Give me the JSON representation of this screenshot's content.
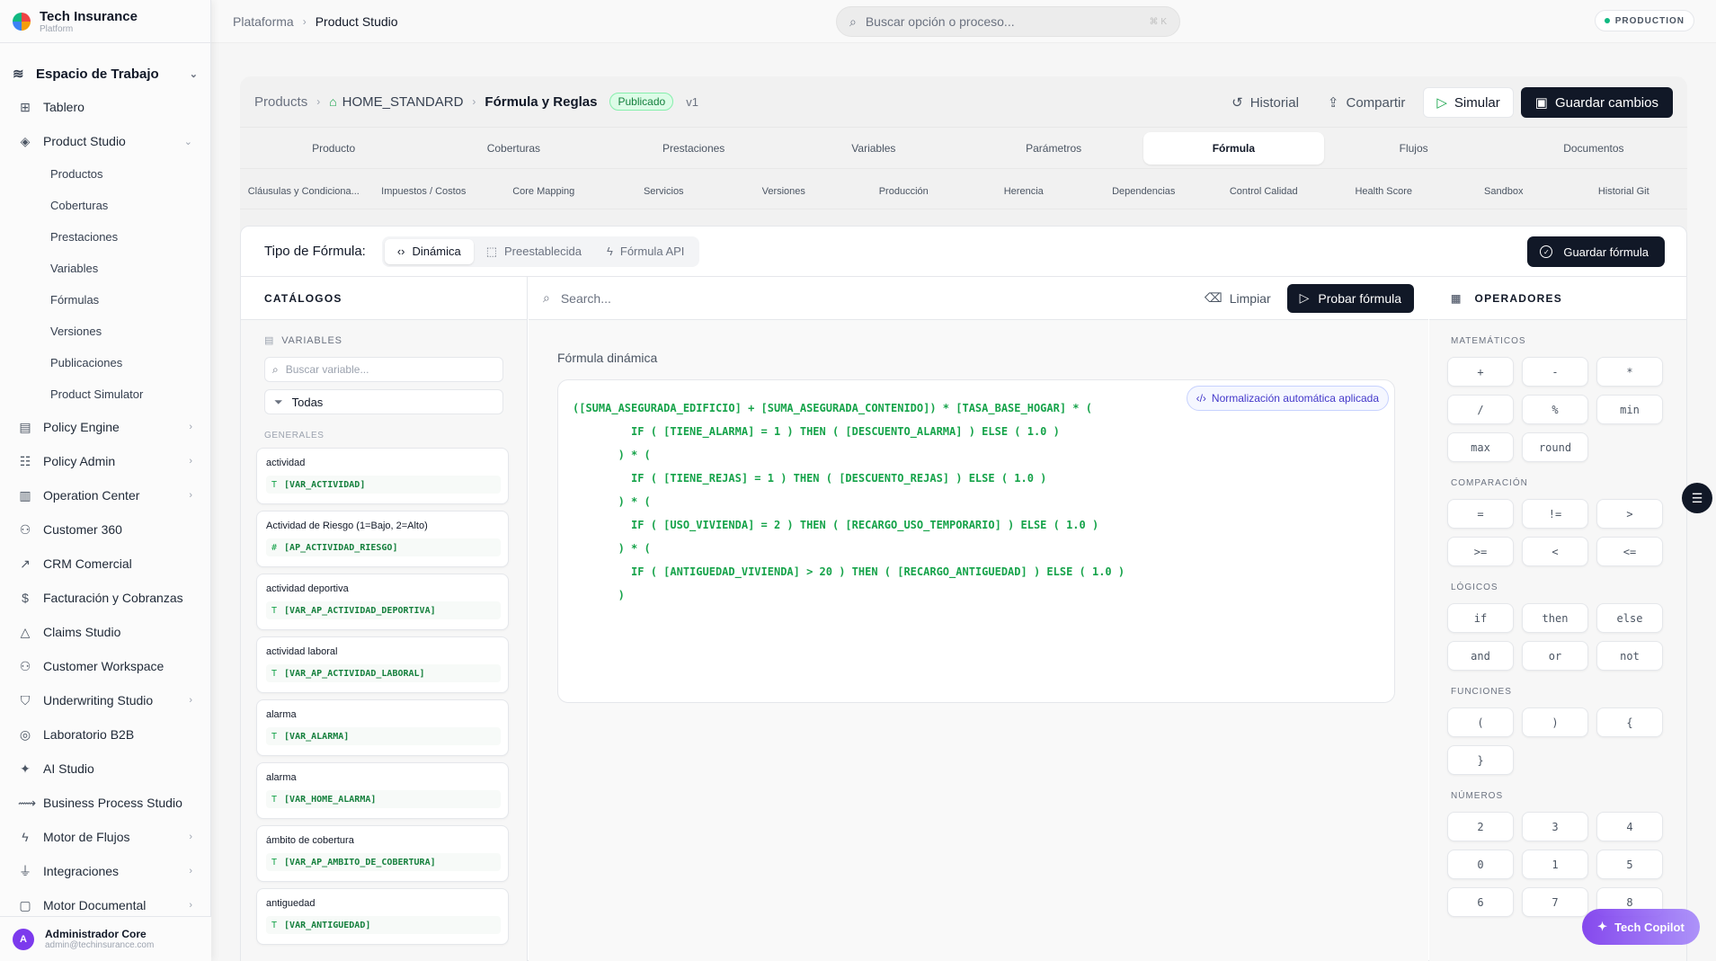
{
  "brand": {
    "name": "Tech Insurance",
    "sub": "Platform"
  },
  "workspace": {
    "label": "Espacio de Trabajo"
  },
  "nav": [
    {
      "label": "Tablero",
      "icon": "grid-icon",
      "chevron": false
    },
    {
      "label": "Product Studio",
      "icon": "box-icon",
      "chevron": true,
      "expanded": true
    },
    {
      "label": "Policy Engine",
      "icon": "file-icon",
      "chevron": true
    },
    {
      "label": "Policy Admin",
      "icon": "sliders-icon",
      "chevron": true
    },
    {
      "label": "Operation Center",
      "icon": "building-icon",
      "chevron": true
    },
    {
      "label": "Customer 360",
      "icon": "users-icon",
      "chevron": false
    },
    {
      "label": "CRM Comercial",
      "icon": "trend-icon",
      "chevron": false
    },
    {
      "label": "Facturación y Cobranzas",
      "icon": "dollar-icon",
      "chevron": false
    },
    {
      "label": "Claims Studio",
      "icon": "alert-icon",
      "chevron": false
    },
    {
      "label": "Customer Workspace",
      "icon": "users-icon",
      "chevron": false
    },
    {
      "label": "Underwriting Studio",
      "icon": "shield-icon",
      "chevron": true
    },
    {
      "label": "Laboratorio B2B",
      "icon": "globe-icon",
      "chevron": false
    },
    {
      "label": "AI Studio",
      "icon": "sparkle-icon",
      "chevron": false
    },
    {
      "label": "Business Process Studio",
      "icon": "flow-icon",
      "chevron": false
    },
    {
      "label": "Motor de Flujos",
      "icon": "bolt-icon",
      "chevron": true
    },
    {
      "label": "Integraciones",
      "icon": "plug-icon",
      "chevron": true
    },
    {
      "label": "Motor Documental",
      "icon": "doc-icon",
      "chevron": true
    }
  ],
  "product_sub": [
    "Productos",
    "Coberturas",
    "Prestaciones",
    "Variables",
    "Fórmulas",
    "Versiones",
    "Publicaciones",
    "Product Simulator"
  ],
  "user": {
    "initial": "A",
    "name": "Administrador Core",
    "email": "admin@techinsurance.com"
  },
  "topbar": {
    "crumb1": "Plataforma",
    "crumb2": "Product Studio",
    "search_placeholder": "Buscar opción o proceso...",
    "shortcut": "⌘ K",
    "env": "PRODUCTION"
  },
  "header": {
    "c1": "Products",
    "c2": "HOME_STANDARD",
    "c3": "Fórmula y Reglas",
    "status": "Publicado",
    "version": "v1",
    "historial": "Historial",
    "compartir": "Compartir",
    "simular": "Simular",
    "guardar": "Guardar cambios"
  },
  "tabs1": [
    "Producto",
    "Coberturas",
    "Prestaciones",
    "Variables",
    "Parámetros",
    "Fórmula",
    "Flujos",
    "Documentos"
  ],
  "tabs1_active": 5,
  "tabs2": [
    "Cláusulas y Condiciona...",
    "Impuestos / Costos",
    "Core Mapping",
    "Servicios",
    "Versiones",
    "Producción",
    "Herencia",
    "Dependencias",
    "Control Calidad",
    "Health Score",
    "Sandbox",
    "Historial Git"
  ],
  "formula_type": {
    "label": "Tipo de Fórmula:",
    "options": [
      "Dinámica",
      "Preestablecida",
      "Fórmula API"
    ],
    "save": "Guardar fórmula"
  },
  "catalog": {
    "title": "CATÁLOGOS",
    "section": "VARIABLES",
    "search_placeholder": "Buscar variable...",
    "filter": "Todas",
    "group": "GENERALES",
    "vars": [
      {
        "name": "actividad",
        "code": "[VAR_ACTIVIDAD]",
        "type": "T"
      },
      {
        "name": "Actividad de Riesgo (1=Bajo, 2=Alto)",
        "code": "[AP_ACTIVIDAD_RIESGO]",
        "type": "#"
      },
      {
        "name": "actividad deportiva",
        "code": "[VAR_AP_ACTIVIDAD_DEPORTIVA]",
        "type": "T"
      },
      {
        "name": "actividad laboral",
        "code": "[VAR_AP_ACTIVIDAD_LABORAL]",
        "type": "T"
      },
      {
        "name": "alarma",
        "code": "[VAR_ALARMA]",
        "type": "T"
      },
      {
        "name": "alarma",
        "code": "[VAR_HOME_ALARMA]",
        "type": "T"
      },
      {
        "name": "ámbito de cobertura",
        "code": "[VAR_AP_AMBITO_DE_COBERTURA]",
        "type": "T"
      },
      {
        "name": "antiguedad",
        "code": "[VAR_ANTIGUEDAD]",
        "type": "T"
      }
    ]
  },
  "editor": {
    "search_placeholder": "Search...",
    "clear": "Limpiar",
    "test": "Probar fórmula",
    "label": "Fórmula dinámica",
    "normalized": "Normalización automática aplicada",
    "lines": [
      "([SUMA_ASEGURADA_EDIFICIO] + [SUMA_ASEGURADA_CONTENIDO]) * [TASA_BASE_HOGAR] * (",
      "         IF ( [TIENE_ALARMA] = 1 ) THEN ( [DESCUENTO_ALARMA] ) ELSE ( 1.0 )",
      "       ) * (",
      "         IF ( [TIENE_REJAS] = 1 ) THEN ( [DESCUENTO_REJAS] ) ELSE ( 1.0 )",
      "       ) * (",
      "         IF ( [USO_VIVIENDA] = 2 ) THEN ( [RECARGO_USO_TEMPORARIO] ) ELSE ( 1.0 )",
      "       ) * (",
      "         IF ( [ANTIGUEDAD_VIVIENDA] > 20 ) THEN ( [RECARGO_ANTIGUEDAD] ) ELSE ( 1.0 )",
      "       )"
    ]
  },
  "operators": {
    "title": "OPERADORES",
    "sections": [
      {
        "name": "MATEMÁTICOS",
        "ops": [
          "+",
          "-",
          "*",
          "/",
          "%",
          "min",
          "max",
          "round"
        ]
      },
      {
        "name": "COMPARACIÓN",
        "ops": [
          "=",
          "!=",
          ">",
          ">=",
          "<",
          "<="
        ]
      },
      {
        "name": "LÓGICOS",
        "ops": [
          "if",
          "then",
          "else",
          "and",
          "or",
          "not"
        ]
      },
      {
        "name": "FUNCIONES",
        "ops": [
          "(",
          ")",
          "{",
          "}"
        ]
      },
      {
        "name": "NÚMEROS",
        "ops": [
          "2",
          "3",
          "4",
          "0",
          "1",
          "5",
          "6",
          "7",
          "8"
        ]
      }
    ]
  },
  "copilot": "Tech Copilot"
}
